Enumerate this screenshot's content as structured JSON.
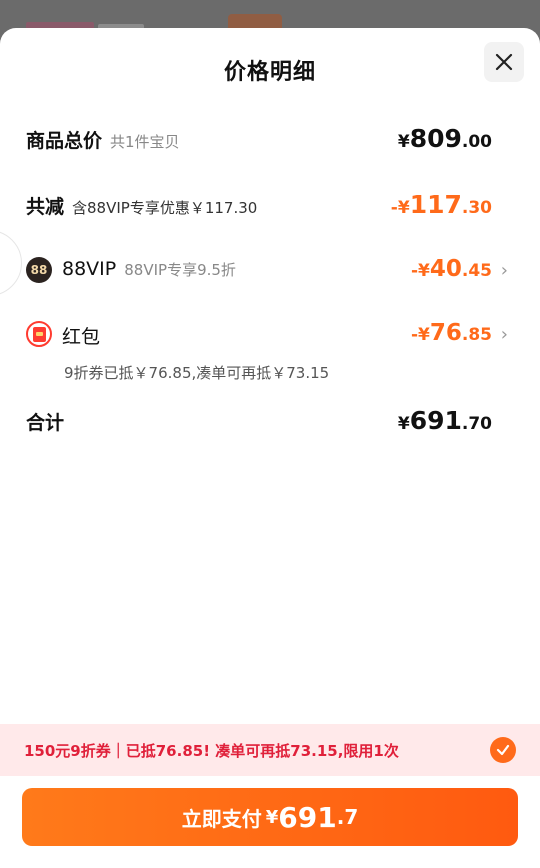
{
  "sheet": {
    "title": "价格明细"
  },
  "rows": {
    "goods_total": {
      "label": "商品总价",
      "sub": "共1件宝贝",
      "yen": "¥",
      "int": "809",
      "dec": ".00"
    },
    "discount": {
      "label": "共减",
      "sub": "含88VIP专享优惠￥117.30",
      "prefix": "-¥",
      "int": "117",
      "dec": ".30"
    },
    "vip": {
      "icon_text": "88",
      "label": "88VIP",
      "sub": "88VIP专享9.5折",
      "prefix": "-¥",
      "int": "40",
      "dec": ".45"
    },
    "hongbao": {
      "label": "红包",
      "note": "9折券已抵￥76.85,凑单可再抵￥73.15",
      "prefix": "-¥",
      "int": "76",
      "dec": ".85"
    },
    "total": {
      "label": "合计",
      "yen": "¥",
      "int": "691",
      "dec": ".70"
    }
  },
  "promo": {
    "text": "150元9折券｜已抵76.85! 凑单可再抵73.15,限用1次"
  },
  "pay": {
    "label": "立即支付",
    "yen": "¥",
    "int": "691",
    "dec": ".7"
  },
  "colors": {
    "accent": "#ff6a1a",
    "promo_text": "#e0203a",
    "promo_bg": "#ffe9ea"
  }
}
